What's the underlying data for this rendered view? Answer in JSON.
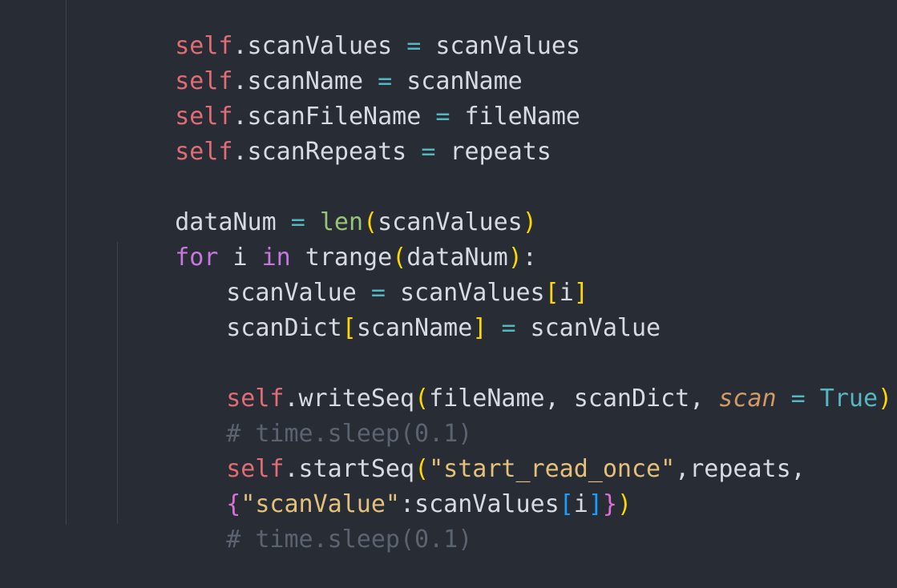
{
  "theme": {
    "background": "#282c34",
    "self_color": "#e06c75",
    "keyword_color": "#c678dd",
    "builtin_color": "#98c379",
    "string_color": "#e5c07b",
    "comment_color": "#5c6370",
    "bracket_colors": [
      "#ffd700",
      "#da70d6",
      "#179fff"
    ]
  },
  "code": {
    "l1": {
      "self": "self",
      "rest_a": ".scanValues ",
      "op": "=",
      "rest_b": " scanValues"
    },
    "l2": {
      "self": "self",
      "rest_a": ".scanName ",
      "op": "=",
      "rest_b": " scanName"
    },
    "l3": {
      "self": "self",
      "rest_a": ".scanFileName ",
      "op": "=",
      "rest_b": " fileName"
    },
    "l4": {
      "self": "self",
      "rest_a": ".scanRepeats ",
      "op": "=",
      "rest_b": " repeats"
    },
    "l5": {
      "a": "dataNum ",
      "op": "=",
      "sp": " ",
      "builtin": "len",
      "open": "(",
      "arg": "scanValues",
      "close": ")"
    },
    "l6": {
      "kw1": "for",
      "a": " i ",
      "kw2": "in",
      "b": " trange",
      "open": "(",
      "arg": "dataNum",
      "close": ")",
      "colon": ":"
    },
    "l7": {
      "a": "scanValue ",
      "op": "=",
      "b": " scanValues",
      "open": "[",
      "arg": "i",
      "close": "]"
    },
    "l8": {
      "a": "scanDict",
      "open": "[",
      "arg": "scanName",
      "close": "]",
      "sp": " ",
      "op": "=",
      "b": " scanValue"
    },
    "l9": {
      "self": "self",
      "a": ".writeSeq",
      "open": "(",
      "args": "fileName, scanDict, ",
      "param": "scan",
      "sp": " ",
      "op": "=",
      "sp2": " ",
      "const": "True",
      "close": ")"
    },
    "l10": {
      "comment": "# time.sleep(0.1)"
    },
    "l11": {
      "self": "self",
      "a": ".startSeq",
      "open": "(",
      "str": "\"start_read_once\"",
      "b": ",repeats,"
    },
    "l12": {
      "open_brace": "{",
      "str": "\"scanValue\"",
      "colon": ":scanValues",
      "open_sq": "[",
      "arg": "i",
      "close_sq": "]",
      "close_brace": "}",
      "close": ")"
    },
    "l13": {
      "comment": "# time.sleep(0.1)"
    }
  }
}
